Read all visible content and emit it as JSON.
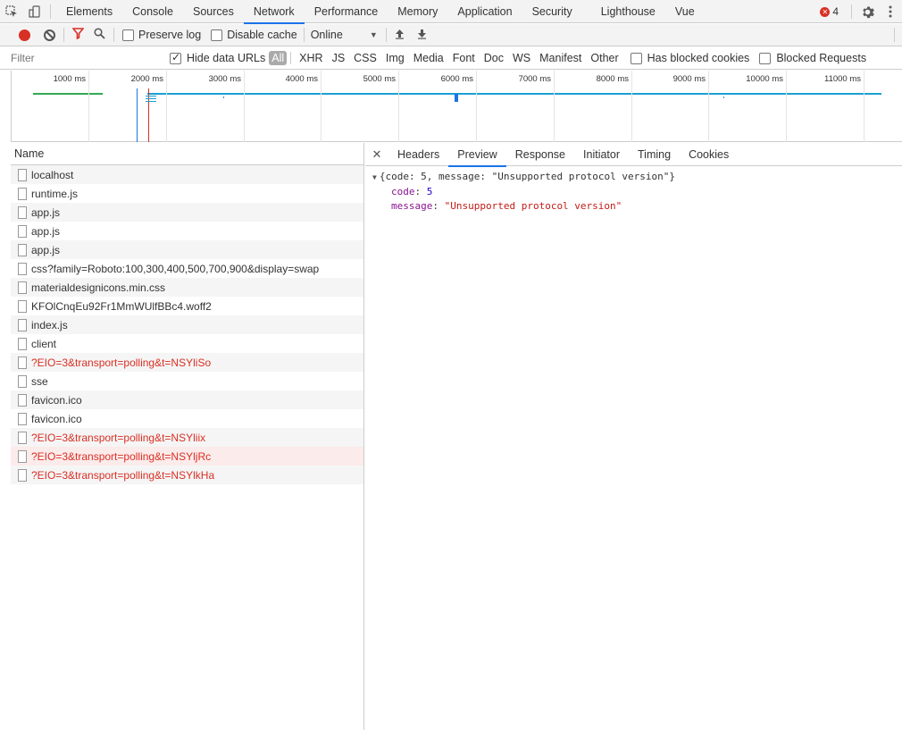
{
  "topbar": {
    "tabs": [
      "Elements",
      "Console",
      "Sources",
      "Network",
      "Performance",
      "Memory",
      "Application",
      "Security",
      "Lighthouse",
      "Vue"
    ],
    "active_tab": "Network",
    "error_count": "4"
  },
  "toolbar": {
    "preserve_log": "Preserve log",
    "disable_cache": "Disable cache",
    "throttling": "Online"
  },
  "filterbar": {
    "placeholder": "Filter",
    "hide_data_urls": "Hide data URLs",
    "types": [
      "All",
      "XHR",
      "JS",
      "CSS",
      "Img",
      "Media",
      "Font",
      "Doc",
      "WS",
      "Manifest",
      "Other"
    ],
    "has_blocked_cookies": "Has blocked cookies",
    "blocked_requests": "Blocked Requests"
  },
  "timeline": {
    "ticks": [
      "1000 ms",
      "2000 ms",
      "3000 ms",
      "4000 ms",
      "5000 ms",
      "6000 ms",
      "7000 ms",
      "8000 ms",
      "9000 ms",
      "10000 ms",
      "11000 ms"
    ]
  },
  "requests": {
    "header": "Name",
    "rows": [
      {
        "name": "localhost",
        "error": false
      },
      {
        "name": "runtime.js",
        "error": false
      },
      {
        "name": "app.js",
        "error": false
      },
      {
        "name": "app.js",
        "error": false
      },
      {
        "name": "app.js",
        "error": false
      },
      {
        "name": "css?family=Roboto:100,300,400,500,700,900&display=swap",
        "error": false
      },
      {
        "name": "materialdesignicons.min.css",
        "error": false
      },
      {
        "name": "KFOlCnqEu92Fr1MmWUlfBBc4.woff2",
        "error": false
      },
      {
        "name": "index.js",
        "error": false
      },
      {
        "name": "client",
        "error": false
      },
      {
        "name": "?EIO=3&transport=polling&t=NSYliSo",
        "error": true
      },
      {
        "name": "sse",
        "error": false
      },
      {
        "name": "favicon.ico",
        "error": false
      },
      {
        "name": "favicon.ico",
        "error": false
      },
      {
        "name": "?EIO=3&transport=polling&t=NSYliix",
        "error": true
      },
      {
        "name": "?EIO=3&transport=polling&t=NSYljRc",
        "error": true
      },
      {
        "name": "?EIO=3&transport=polling&t=NSYlkHa",
        "error": true
      }
    ]
  },
  "detail": {
    "tabs": [
      "Headers",
      "Preview",
      "Response",
      "Initiator",
      "Timing",
      "Cookies"
    ],
    "active_tab": "Preview",
    "summary": "{code: 5, message: \"Unsupported protocol version\"}",
    "code_key": "code",
    "code_value": "5",
    "message_key": "message",
    "message_value": "\"Unsupported protocol version\""
  }
}
